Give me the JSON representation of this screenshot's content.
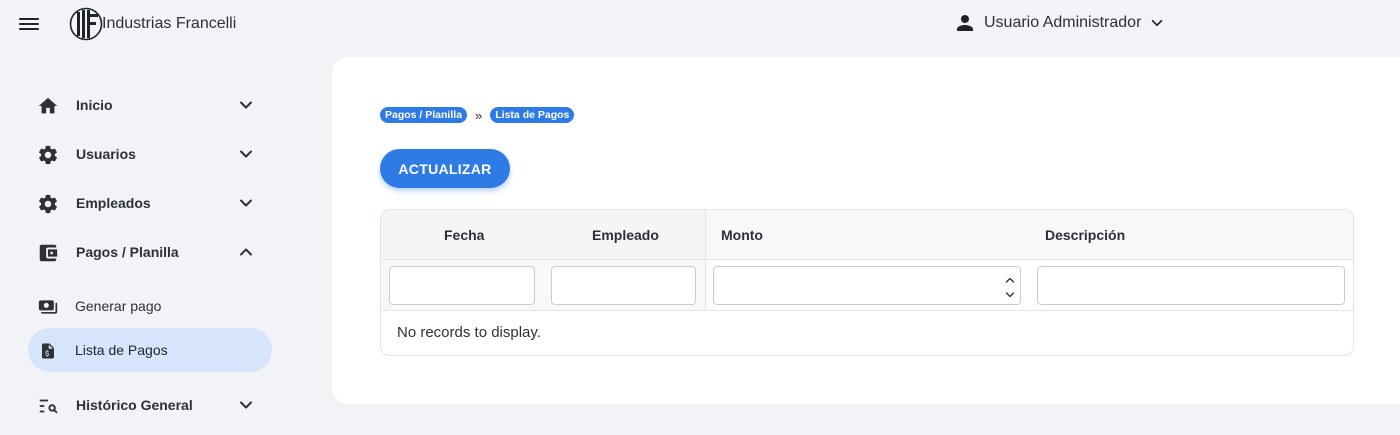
{
  "header": {
    "brand": "Industrias Francelli",
    "user_name": "Usuario Administrador",
    "icons": {
      "menu": "hamburger-icon",
      "logo": "francelli-logo",
      "user": "person-icon",
      "user_menu": "chevron-down-icon"
    }
  },
  "sidebar": {
    "items": [
      {
        "label": "Inicio",
        "icon": "home-icon",
        "expanded": false
      },
      {
        "label": "Usuarios",
        "icon": "gear-icon",
        "expanded": false
      },
      {
        "label": "Empleados",
        "icon": "gear-icon",
        "expanded": false
      },
      {
        "label": "Pagos / Planilla",
        "icon": "wallet-icon",
        "expanded": true
      },
      {
        "label": "Histórico General",
        "icon": "list-search-icon",
        "expanded": false
      }
    ],
    "subitems": [
      {
        "label": "Generar pago",
        "icon": "payments-icon",
        "active": false
      },
      {
        "label": "Lista de Pagos",
        "icon": "invoice-dollar-icon",
        "active": true
      }
    ]
  },
  "main": {
    "breadcrumb": [
      "Pagos / Planilla",
      "Lista de Pagos"
    ],
    "breadcrumb_separator": "»",
    "refresh_button": "ACTUALIZAR",
    "table": {
      "columns": [
        "Fecha",
        "Empleado",
        "Monto",
        "Descripción"
      ],
      "filters": [
        "",
        "",
        "",
        ""
      ],
      "empty_message": "No records to display."
    }
  },
  "colors": {
    "accent": "#2f7be6",
    "active_item_bg": "#d6e5fb",
    "page_bg": "#f1f3f6"
  }
}
